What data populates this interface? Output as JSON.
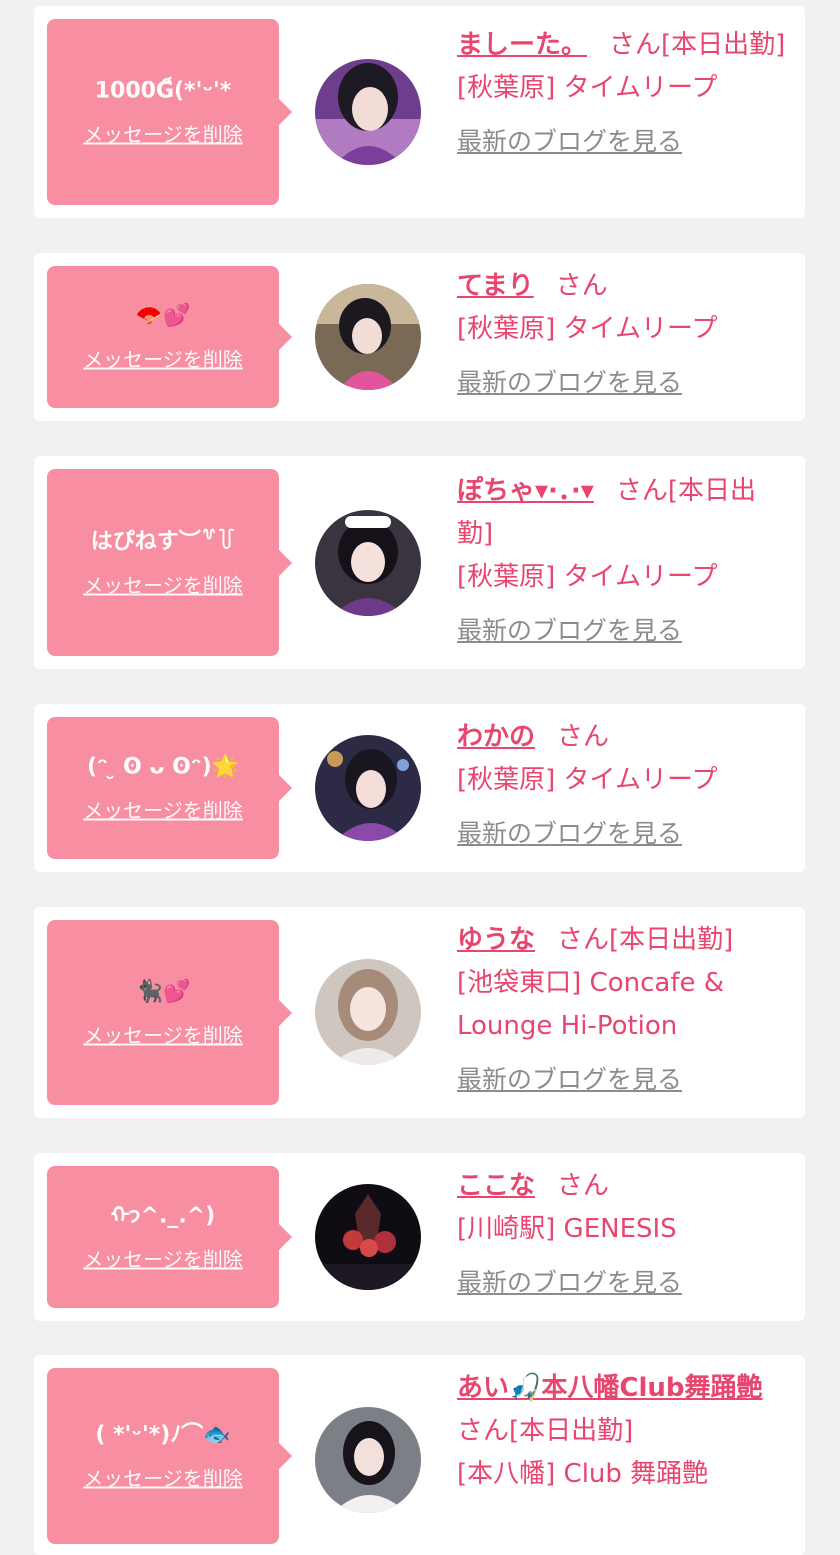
{
  "common": {
    "delete_label": "メッセージを削除",
    "blog_label": "最新のブログを見る"
  },
  "colors": {
    "page_bg": "#f1f1f1",
    "bubble": "#f78ea1",
    "name_text": "#e8466e",
    "link_grey": "#8c8c8c"
  },
  "entries": [
    {
      "message": "1000G็(*'ᵕ'*",
      "name": "ましーた。",
      "suffix": "さん[本日出勤]",
      "shop": "[秋葉原] タイムリープ"
    },
    {
      "message": "🪭💕",
      "name": "てまり",
      "suffix": "さん",
      "shop": "[秋葉原] タイムリープ"
    },
    {
      "message": "はぴねす︶꒷꒦",
      "name": "ぽちゃ▾·．·▾",
      "suffix": "さん[本日出勤]",
      "shop": "[秋葉原] タイムリープ"
    },
    {
      "message": "(ᵔ ̮ ʘ ᴗ ʘᵔ)🌟",
      "name": "わかの",
      "suffix": "さん",
      "shop": "[秋葉原] タイムリープ"
    },
    {
      "message": "🐈‍⬛💕",
      "name": "ゆうな",
      "suffix": "さん[本日出勤]",
      "shop": "[池袋東口] Concafe & Lounge Hi-Potion"
    },
    {
      "message": "ᡣ𐭩^._.^)",
      "name": "ここな",
      "suffix": "さん",
      "shop": "[川崎駅] GENESIS"
    },
    {
      "message": "( *'ᵕ'*)ﾉ⌒🐟",
      "name": "あい🎣本八幡Club舞踊艶",
      "suffix": "さん[本日出勤]",
      "shop": "[本八幡] Club 舞踊艶"
    }
  ]
}
